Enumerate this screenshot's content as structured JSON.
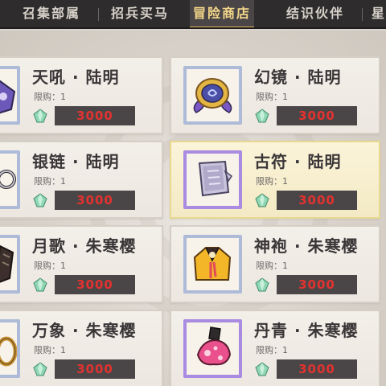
{
  "tabs": [
    {
      "label": "召集部属",
      "active": false
    },
    {
      "label": "招兵买马",
      "active": false
    },
    {
      "label": "冒险商店",
      "active": true
    },
    {
      "label": "结识伙伴",
      "active": false
    },
    {
      "label": "星",
      "active": false
    }
  ],
  "limit_label": "限购：1",
  "currency_icon": "green-crystal-icon",
  "colors": {
    "tab_active": "#f4d88a",
    "price_text": "#e2322f",
    "price_bg": "#4a4648"
  },
  "items": [
    {
      "name": "天吼 · 陆明",
      "limit": "限购：1",
      "price": "3000",
      "icon": "purple-relic-icon"
    },
    {
      "name": "幻镜 · 陆明",
      "limit": "限购：1",
      "price": "3000",
      "icon": "golden-mirror-icon"
    },
    {
      "name": "银链 · 陆明",
      "limit": "限购：1",
      "price": "3000",
      "icon": "silver-chain-icon"
    },
    {
      "name": "古符 · 陆明",
      "limit": "限购：1",
      "price": "3000",
      "icon": "stone-tablet-icon",
      "selected": true
    },
    {
      "name": "月歌 · 朱寒樱",
      "limit": "限购：1",
      "price": "3000",
      "icon": "dark-relic-icon"
    },
    {
      "name": "神袍 · 朱寒樱",
      "limit": "限购：1",
      "price": "3000",
      "icon": "golden-robe-icon"
    },
    {
      "name": "万象 · 朱寒樱",
      "limit": "限购：1",
      "price": "3000",
      "icon": "golden-ring-icon"
    },
    {
      "name": "丹青 · 朱寒樱",
      "limit": "限购：1",
      "price": "3000",
      "icon": "pink-brush-icon"
    }
  ]
}
